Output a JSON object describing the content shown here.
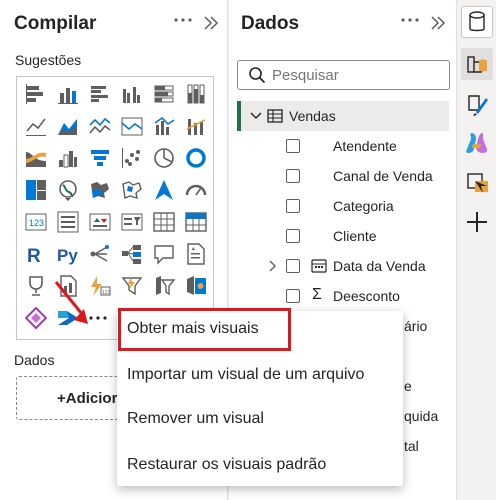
{
  "build_pane": {
    "title": "Compilar",
    "more_icon": "ellipsis-icon",
    "collapse_icon": "chevron-double-right-icon",
    "suggestions_label": "Sugestões",
    "dados_label": "Dados",
    "add_button_label": "+Adicior",
    "more_visuals_label": "· · ·"
  },
  "data_pane": {
    "title": "Dados",
    "search": {
      "placeholder": "Pesquisar"
    },
    "table": {
      "name": "Vendas",
      "icon": "table-icon"
    },
    "fields": [
      {
        "label": "Atendente",
        "type": "text"
      },
      {
        "label": "Canal de Venda",
        "type": "text"
      },
      {
        "label": "Categoria",
        "type": "text"
      },
      {
        "label": "Cliente",
        "type": "text"
      },
      {
        "label": "Data da Venda",
        "type": "date-hierarchy"
      },
      {
        "label": "Deesconto",
        "type": "sum"
      },
      {
        "label": "ário",
        "type": "partial"
      },
      {
        "label": "e",
        "type": "partial"
      },
      {
        "label": "quida",
        "type": "partial"
      },
      {
        "label": "tal",
        "type": "partial"
      }
    ]
  },
  "context_menu": {
    "items": [
      {
        "label": "Obter mais visuais"
      },
      {
        "label": "Importar um visual de um arquivo"
      },
      {
        "label": "Remover um visual"
      },
      {
        "label": "Restaurar os visuais padrão"
      }
    ]
  },
  "colors": {
    "accent_green": "#1e7145",
    "highlight_red": "#e0161e",
    "arrow_red": "#e0161e",
    "viz_blue": "#0078d4"
  }
}
